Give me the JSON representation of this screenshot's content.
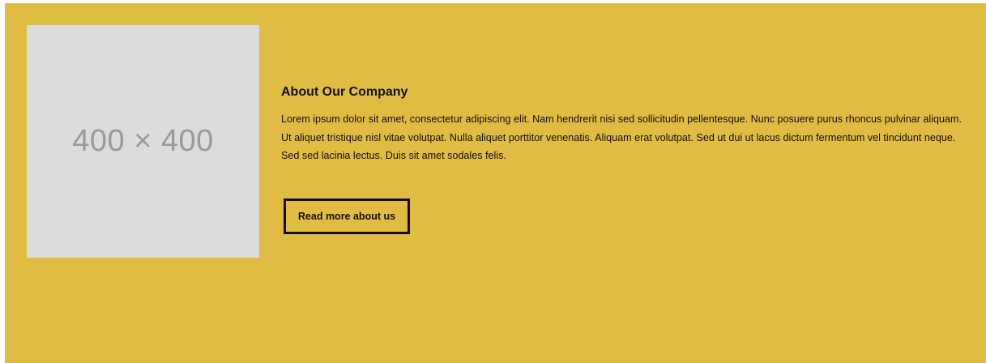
{
  "about": {
    "image_placeholder": "400 × 400",
    "heading": "About Our Company",
    "body": "Lorem ipsum dolor sit amet, consectetur adipiscing elit. Nam hendrerit nisi sed sollicitudin pellentesque. Nunc posuere purus rhoncus pulvinar aliquam. Ut aliquet tristique nisl vitae volutpat. Nulla aliquet porttitor venenatis. Aliquam erat volutpat. Sed ut dui ut lacus dictum fermentum vel tincidunt neque. Sed sed lacinia lectus. Duis sit amet sodales felis.",
    "button_label": "Read more about us"
  },
  "colors": {
    "section_background": "#e0bd42",
    "placeholder_background": "#dcdcdc",
    "placeholder_text": "#9a9a9a",
    "text": "#111111"
  }
}
